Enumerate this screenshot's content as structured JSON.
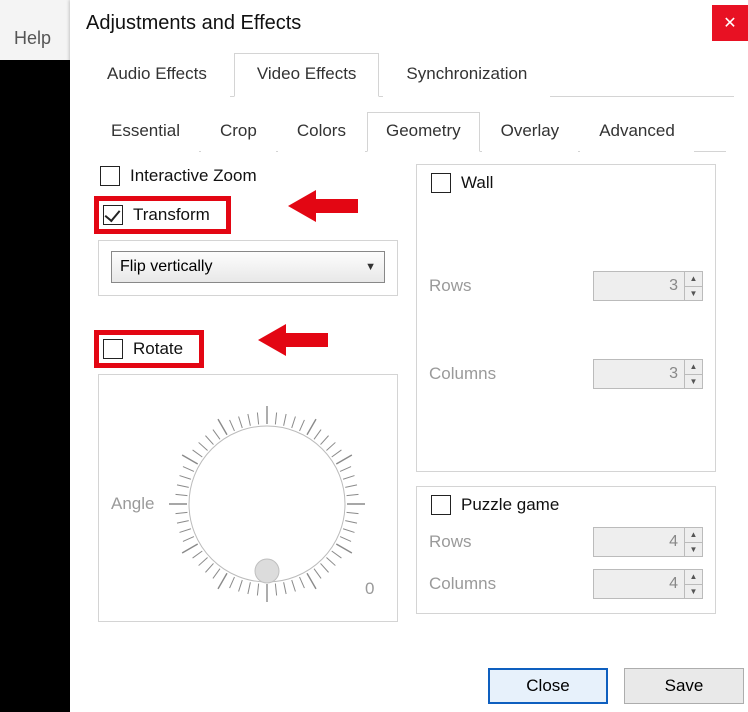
{
  "helpMenu": "Help",
  "dialogTitle": "Adjustments and Effects",
  "mainTabs": {
    "audio": "Audio Effects",
    "video": "Video Effects",
    "sync": "Synchronization"
  },
  "subTabs": {
    "essential": "Essential",
    "crop": "Crop",
    "colors": "Colors",
    "geometry": "Geometry",
    "overlay": "Overlay",
    "advanced": "Advanced"
  },
  "geometry": {
    "interactiveZoom": "Interactive Zoom",
    "transform": "Transform",
    "transformMode": "Flip vertically",
    "rotate": "Rotate",
    "angleLabel": "Angle",
    "angleZero": "0",
    "wall": "Wall",
    "rowsLabel": "Rows",
    "columnsLabel": "Columns",
    "wallRows": "3",
    "wallColumns": "3",
    "puzzle": "Puzzle game",
    "puzzleRows": "4",
    "puzzleColumns": "4"
  },
  "buttons": {
    "close": "Close",
    "save": "Save"
  }
}
